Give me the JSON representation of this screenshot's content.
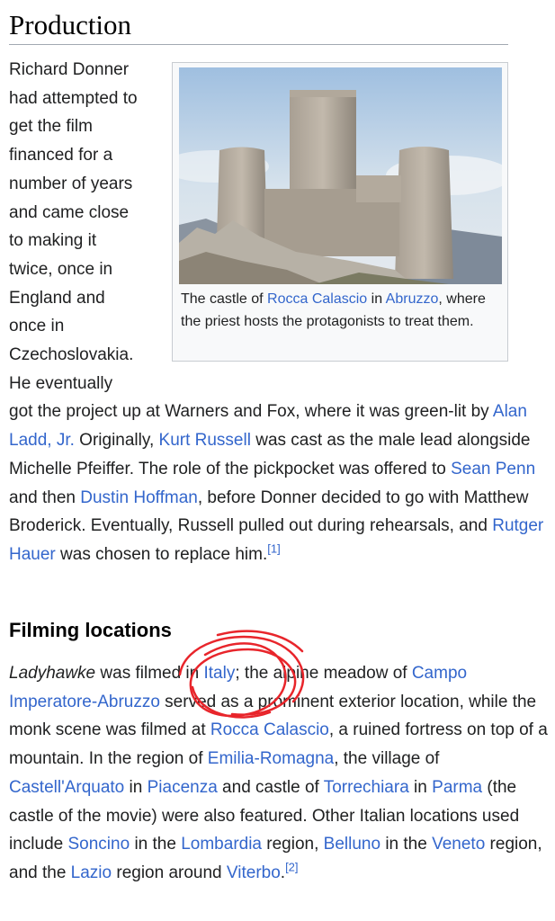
{
  "section": {
    "title": "Production"
  },
  "figure": {
    "caption_pre": "The castle of ",
    "caption_link1": "Rocca Calascio",
    "caption_mid": " in ",
    "caption_link2": "Abruzzo",
    "caption_post": ", where the priest hosts the protagonists to treat them."
  },
  "production": {
    "lines_narrow": [
      "Richard Donner",
      "had attempted to",
      "get the film",
      "financed for a",
      "number of years",
      "and came close",
      "to making it",
      "twice, once in",
      "England and",
      "once in",
      "Czechoslovakia.",
      "He eventually"
    ],
    "t1": "got the project up at Warners and Fox, where it was green-lit by ",
    "link_ladd": "Alan Ladd, Jr.",
    "t2": " Originally, ",
    "link_russell": "Kurt Russell",
    "t3": " was cast as the male lead alongside Michelle Pfeiffer. The role of the pickpocket was offered to ",
    "link_penn": "Sean Penn",
    "t4": " and then ",
    "link_hoffman": "Dustin Hoffman",
    "t5": ", before Donner decided to go with Matthew Broderick. Eventually, Russell pulled out during rehearsals, and ",
    "link_hauer": "Rutger Hauer",
    "t6": " was chosen to replace him.",
    "ref": "[1]"
  },
  "filming": {
    "title": "Filming locations",
    "film_title": "Ladyhawke",
    "t1": " was filmed in ",
    "link_italy": "Italy",
    "t2": "; the alpine meadow of ",
    "link_campo": "Campo Imperatore-Abruzzo",
    "t3": " served as a prominent exterior location, while the monk scene was filmed at ",
    "link_rocca": "Rocca Calascio",
    "t4": ", a ruined fortress on top of a mountain. In the region of ",
    "link_emilia": "Emilia-Romagna",
    "t5": ", the village of ",
    "link_castell": "Castell'Arquato",
    "t6": " in ",
    "link_piacenza": "Piacenza",
    "t7": " and castle of ",
    "link_torrechiara": "Torrechiara",
    "t8": " in ",
    "link_parma": "Parma",
    "t9": " (the castle of the movie) were also featured. Other Italian locations used include ",
    "link_soncino": "Soncino",
    "t10": " in the ",
    "link_lombardia": "Lombardia",
    "t11": " region, ",
    "link_belluno": "Belluno",
    "t12": " in the ",
    "link_veneto": "Veneto",
    "t13": " region, and the ",
    "link_lazio": "Lazio",
    "t14": " region around ",
    "link_viterbo": "Viterbo",
    "t15": ".",
    "ref": "[2]"
  },
  "colors": {
    "link": "#3366cc",
    "annotation": "#e8252b",
    "text": "#202122"
  }
}
